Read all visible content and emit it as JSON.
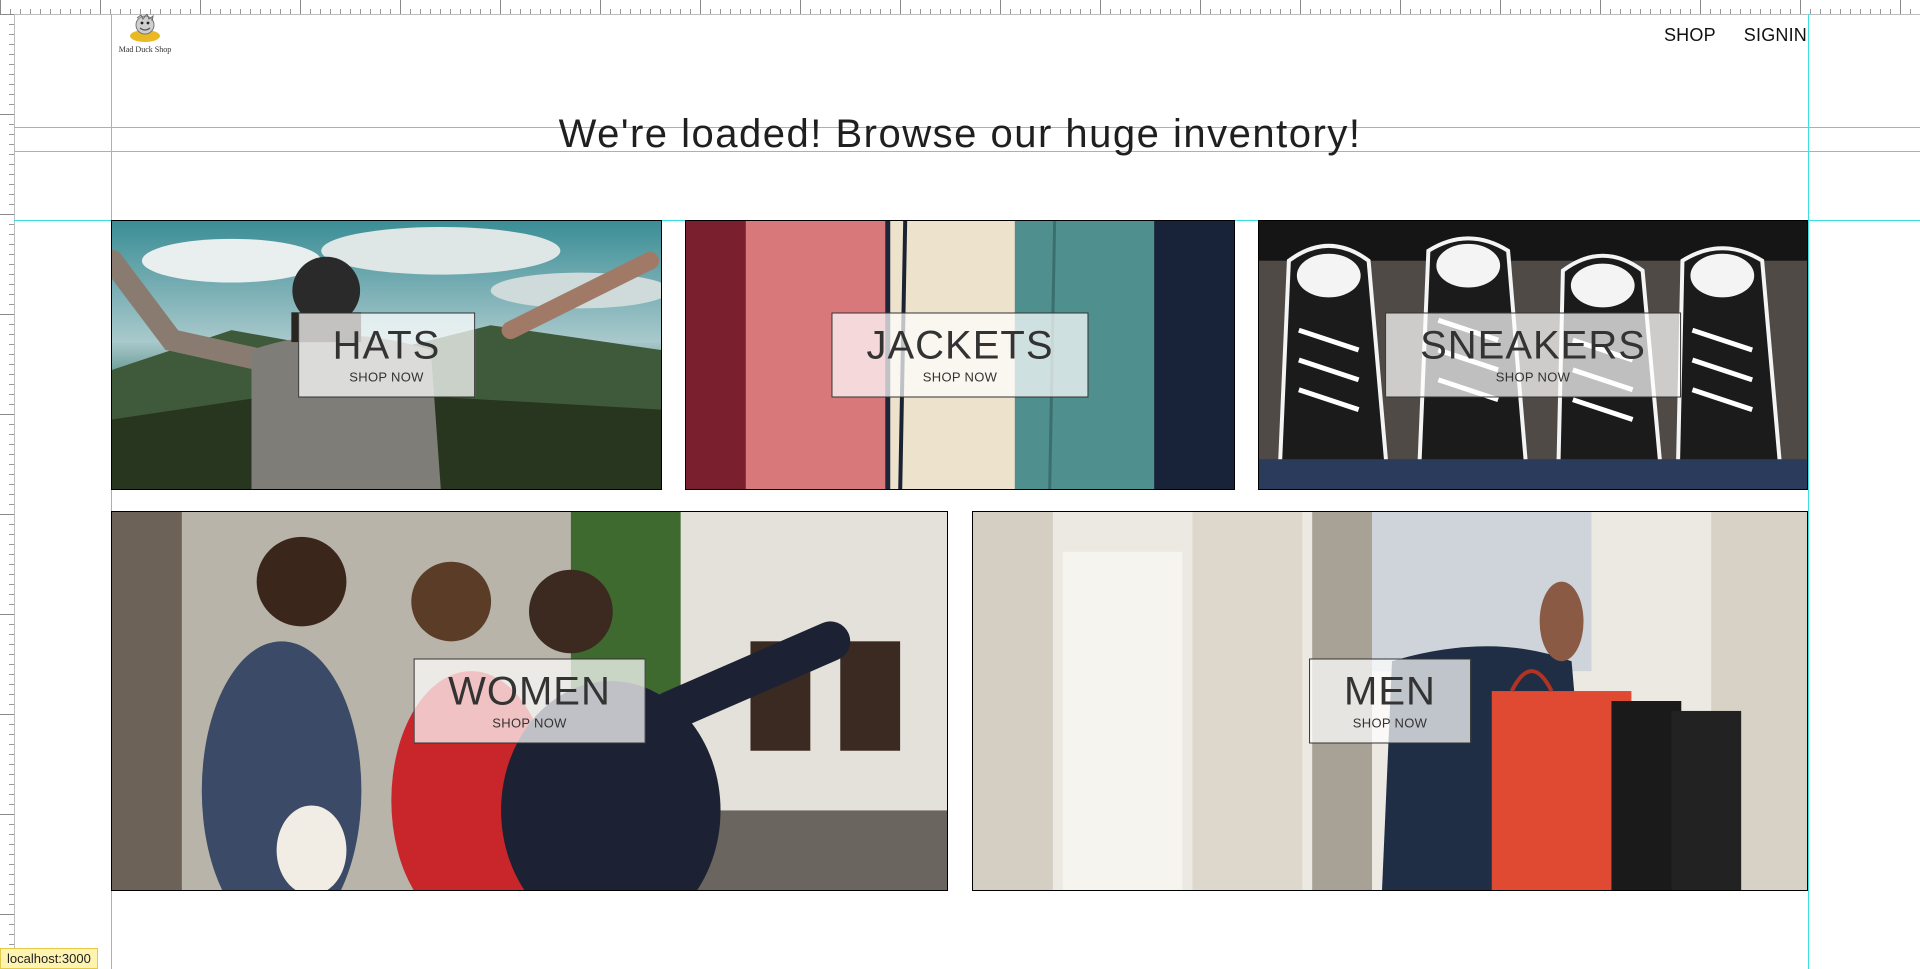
{
  "header": {
    "logo_text": "Mad Duck Shop",
    "nav": [
      {
        "label": "SHOP"
      },
      {
        "label": "SIGNIN"
      }
    ]
  },
  "headline": "We're loaded! Browse our huge inventory!",
  "directory": [
    {
      "title": "HATS",
      "subtitle": "SHOP NOW"
    },
    {
      "title": "JACKETS",
      "subtitle": "SHOP NOW"
    },
    {
      "title": "SNEAKERS",
      "subtitle": "SHOP NOW"
    },
    {
      "title": "WOMEN",
      "subtitle": "SHOP NOW"
    },
    {
      "title": "MEN",
      "subtitle": "SHOP NOW"
    }
  ],
  "status_bar": "localhost:3000",
  "colors": {
    "guide": "#3be0e0",
    "overlay": "#ffffffb8"
  }
}
